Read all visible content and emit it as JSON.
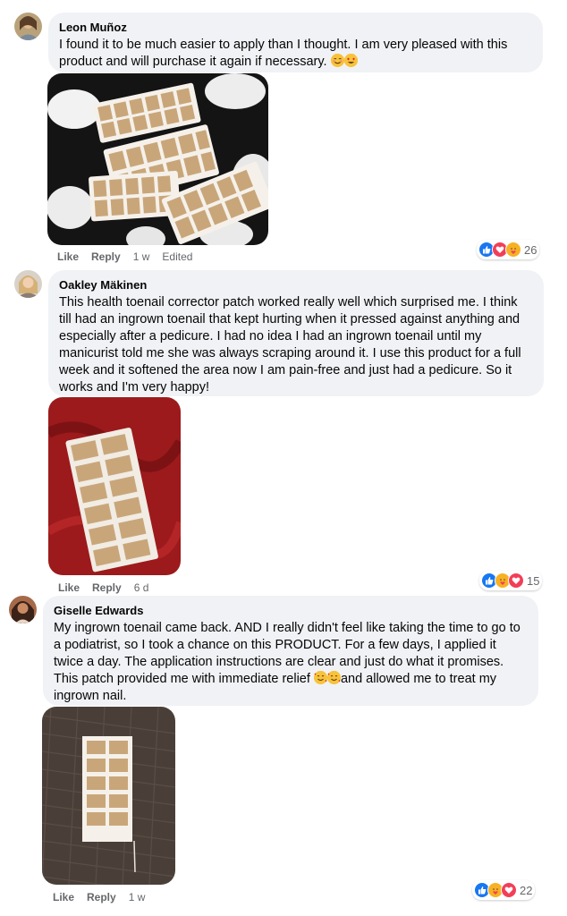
{
  "comments": [
    {
      "author": "Leon Muñoz",
      "text": "I found it to be much easier to apply than I thought. I am very pleased with this product and will purchase it again if necessary.",
      "emojis": [
        "relieved-face",
        "heart-eyes-face"
      ],
      "like_label": "Like",
      "reply_label": "Reply",
      "time": "1 w",
      "edited": "Edited",
      "reaction_count": "26",
      "reaction_icons": [
        "like",
        "love",
        "care"
      ]
    },
    {
      "author": "Oakley Mäkinen",
      "text": "This health toenail corrector patch worked really well which surprised me. I think till had an ingrown toenail that kept hurting when it pressed against anything and especially after a pedicure. I had no idea I had an ingrown toenail until my manicurist told me she was always scraping around it. I use this product for a full week and it softened the area now I am pain-free and just had a pedicure. So it works and I'm very happy!",
      "like_label": "Like",
      "reply_label": "Reply",
      "time": "6 d",
      "reaction_count": "15",
      "reaction_icons": [
        "like",
        "care",
        "love"
      ]
    },
    {
      "author": "Giselle Edwards",
      "text_before": "My ingrown toenail came back. AND I really didn't feel like taking the time to go to a podiatrist, so I took a chance on this PRODUCT. For a few days, I applied it twice a day. The application instructions are clear and just do what it promises. This patch provided me with immediate relief ",
      "text_after": "and allowed me to treat my ingrown nail.",
      "emojis": [
        "smiling-face-with-hearts",
        "smiling-face-with-hearts"
      ],
      "like_label": "Like",
      "reply_label": "Reply",
      "time": "1 w",
      "reaction_count": "22",
      "reaction_icons": [
        "like",
        "care",
        "love"
      ]
    }
  ],
  "colors": {
    "bubble": "#f0f2f5",
    "meta_text": "#65676b",
    "like_blue": "#1877f2",
    "love_red": "#f33e58",
    "care_yellow": "#f7b125"
  }
}
